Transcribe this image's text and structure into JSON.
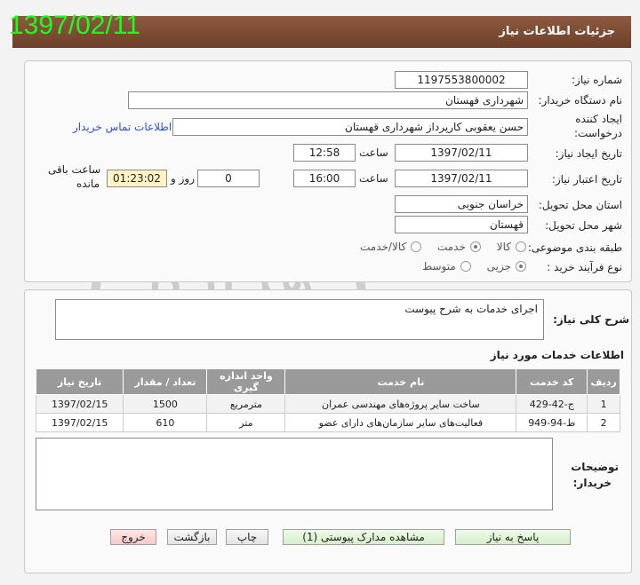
{
  "stamp_date": "1397/02/11",
  "header": {
    "title": "جزئیات اطلاعات نیاز"
  },
  "info": {
    "need_number_label": "شماره نیاز:",
    "need_number": "1197553800002",
    "buyer_org_label": "نام دستگاه خریدار:",
    "buyer_org": "شهرداری قهستان",
    "creator_label_1": "ایجاد کننده",
    "creator_label_2": "درخواست:",
    "creator": "حسن یعقوبی کارپرداز شهرداری قهستان",
    "buyer_contact_link": "اطلاعات تماس خریدار",
    "created_date_label": "تاریخ ایجاد نیاز:",
    "created_date": "1397/02/11",
    "time_label": "ساعت",
    "created_time": "12:58",
    "validity_date_label": "تاریخ اعتبار نیاز:",
    "validity_date": "1397/02/11",
    "validity_time": "16:00",
    "days_value": "0",
    "days_label": "روز و",
    "remaining_time": "01:23:02",
    "remaining_label_1": "ساعت باقی",
    "remaining_label_2": "مانده",
    "delivery_province_label": "استان محل تحویل:",
    "delivery_province": "خراسان جنوبی",
    "delivery_city_label": "شهر محل تحویل:",
    "delivery_city": "قهستان",
    "category_label": "طبقه بندی موضوعی:",
    "category_options": [
      "کالا",
      "خدمت",
      "کالا/خدمت"
    ],
    "category_selected": 1,
    "purchase_type_label": "نوع فرآیند خرید :",
    "purchase_type_options": [
      "جزیی",
      "متوسط"
    ],
    "purchase_type_selected": 0
  },
  "description": {
    "label": "شرح کلی نیاز:",
    "text": "اجرای خدمات به شرح پیوست"
  },
  "services": {
    "section_title": "اطلاعات خدمات مورد نیاز",
    "columns": [
      "ردیف",
      "کد خدمت",
      "نام خدمت",
      "واحد اندازه گیری",
      "تعداد / مقدار",
      "تاریخ نیاز"
    ],
    "rows": [
      [
        "1",
        "ج-42-429",
        "ساخت سایر پروژه‌های مهندسی عمران",
        "مترمربع",
        "1500",
        "1397/02/15"
      ],
      [
        "2",
        "ط-94-949",
        "فعالیت‌های سایر سازمان‌های دارای عضو",
        "متر",
        "610",
        "1397/02/15"
      ]
    ]
  },
  "buyer_notes": {
    "label_1": "توضیحات",
    "label_2": "خریدار:"
  },
  "watermark": {
    "text_main": "هزاره",
    "text_sub": "گستران"
  },
  "buttons": {
    "reply": "پاسخ به نیاز",
    "attachments": "مشاهده مدارک پیوستی (1)",
    "print": "چاپ",
    "back": "بازگشت",
    "exit": "خروج"
  }
}
